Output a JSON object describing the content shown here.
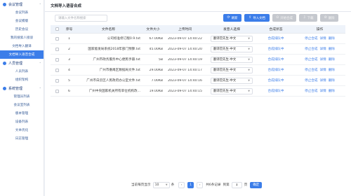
{
  "sidebar": {
    "groups": [
      {
        "label": "会议管理",
        "items": [
          "会议列表",
          "会议模版",
          "历史会议",
          "我的搜索人接驳",
          "文档导入翻译",
          "文档导入语音合成"
        ]
      },
      {
        "label": "人员管理",
        "items": [
          "人员列表",
          "组织架构"
        ]
      },
      {
        "label": "系统管理",
        "items": [
          "管理员列表",
          "会议室列表",
          "版本管理",
          "设备列表",
          "文本优化",
          "日志管理"
        ]
      }
    ]
  },
  "header": {
    "title": "文档导入语音合成"
  },
  "toolbar": {
    "search_placeholder": "请输入文件名称搜索",
    "buttons": [
      {
        "label": "刷新",
        "icon": "refresh-icon",
        "glyph": "⟳",
        "state": "primary"
      },
      {
        "label": "导入文档",
        "icon": "import-icon",
        "glyph": "⇪",
        "state": "primary"
      },
      {
        "label": "开始合成",
        "icon": "play-icon",
        "glyph": "⊙",
        "state": "disabled"
      },
      {
        "label": "下载",
        "icon": "download-icon",
        "glyph": "⇩",
        "state": "disabled"
      },
      {
        "label": "删除",
        "icon": "delete-icon",
        "glyph": "⊘",
        "state": "disabled"
      }
    ]
  },
  "table": {
    "columns": [
      "序号",
      "文件名称",
      "文件大小",
      "上传时间",
      "发音人选择",
      "合成状态",
      "操作"
    ],
    "rows": [
      {
        "no": "1",
        "name": "公司标准修订版0.9.txt",
        "size": "67.00KB",
        "time": "2023-09-07 14:40:22",
        "person": "翻译官先生-中文",
        "status": "合成排队中",
        "ops": [
          "停止合成",
          "详情",
          "删除"
        ]
      },
      {
        "no": "2",
        "name": "国家能发局系统2018年部门预算.txt",
        "size": "45.00KB",
        "time": "2023-09-07 14:40:20",
        "person": "翻译官先生-中文",
        "status": "合成排队中",
        "ops": [
          "停止合成",
          "详情",
          "删除"
        ]
      },
      {
        "no": "3",
        "name": "广州市政务服务中心便民手册.txt",
        "size": "5B",
        "time": "2023-09-07 14:40:19",
        "person": "翻译官先生-中文",
        "status": "合成排队中",
        "ops": [
          "停止合成",
          "详情",
          "删除"
        ]
      },
      {
        "no": "4",
        "name": "广州市番禺区数据局文件.txt",
        "size": "29.00KB",
        "time": "2023-09-07 14:40:17",
        "person": "翻译官先生-中文",
        "status": "合成排队中",
        "ops": [
          "停止合成",
          "详情",
          "删除"
        ]
      },
      {
        "no": "5",
        "name": "广州市白云区人民政府办公室文件.txt",
        "size": "7.00KB",
        "time": "2023-09-07 14:40:16",
        "person": "翻译官先生-中文",
        "status": "合成排队中",
        "ops": [
          "停止合成",
          "详情",
          "删除"
        ]
      },
      {
        "no": "6",
        "name": "广州中央国家机关所有单位机构改...",
        "size": "19.00KB",
        "time": "2023-09-07 14:40:15",
        "person": "翻译官先生-中文",
        "status": "合成排队中",
        "ops": [
          "停止合成",
          "详情",
          "删除"
        ]
      }
    ]
  },
  "pager": {
    "per_page_label": "当前每页显示",
    "per_page_value": "10",
    "per_page_unit": "条",
    "prev": "‹",
    "current_page": "1",
    "next": "›",
    "total_text": "共6条记录",
    "goto_label": "到第",
    "goto_value": "1",
    "goto_unit": "页",
    "go_button": "确定"
  },
  "colors": {
    "accent": "#3b7de9",
    "disabled": "#c5c8ce"
  }
}
